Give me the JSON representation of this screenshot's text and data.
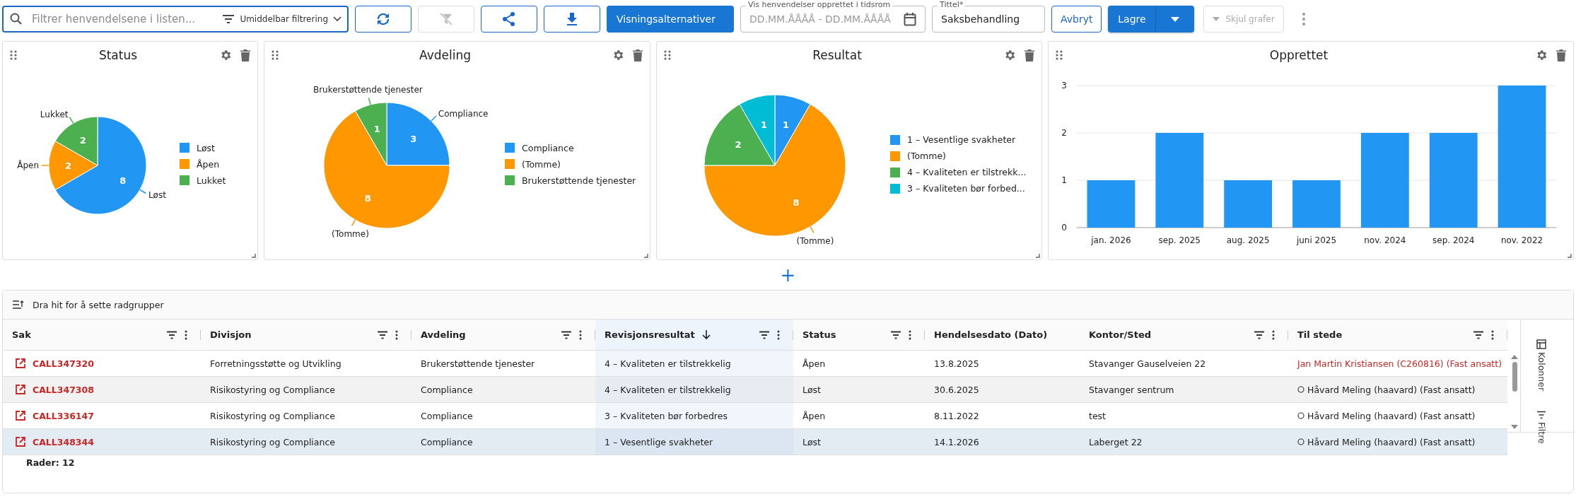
{
  "toolbar": {
    "search": {
      "placeholder": "Filtrer henvendelsene i listen...",
      "filter_mode": "Umiddelbar filtrering"
    },
    "icon_buttons": [
      {
        "kind": "refresh",
        "disabled": false
      },
      {
        "kind": "clear-filter",
        "disabled": true
      },
      {
        "kind": "share",
        "disabled": false
      },
      {
        "kind": "download",
        "disabled": false
      }
    ],
    "view_options": "Visningsalternativer",
    "date_range": {
      "label": "Vis henvendelser opprettet i tidsrom",
      "placeholder": "DD.MM.ÅÅÅÅ - DD.MM.ÅÅÅÅ"
    },
    "title_field": {
      "label": "Tittel*",
      "value": "Saksbehandling"
    },
    "cancel": "Avbryt",
    "save": "Lagre",
    "hide_charts": {
      "label": "Skjul grafer",
      "disabled": true
    }
  },
  "charts": [
    {
      "title": "Status",
      "chart_data": {
        "type": "pie",
        "categories": [
          "Løst",
          "Åpen",
          "Lukket"
        ],
        "values": [
          8,
          2,
          2
        ],
        "data_labels": true
      },
      "legend": [
        {
          "color": "#2196f3",
          "callout": true
        },
        {
          "color": "#ff9800",
          "callout": true
        },
        {
          "color": "#4caf50",
          "callout": true
        }
      ]
    },
    {
      "title": "Avdeling",
      "chart_data": {
        "type": "pie",
        "categories": [
          "Compliance",
          "(Tomme)",
          "Brukerstøttende tjenester"
        ],
        "values": [
          3,
          8,
          1
        ],
        "data_labels": true
      },
      "legend": [
        {
          "color": "#2196f3",
          "callout": true
        },
        {
          "color": "#ff9800",
          "callout": true
        },
        {
          "color": "#4caf50",
          "callout": true
        }
      ]
    },
    {
      "title": "Resultat",
      "chart_data": {
        "type": "pie",
        "categories": [
          "1 – Vesentlige svakheter",
          "(Tomme)",
          "4 – Kvaliteten er tilstrekk...",
          "3 – Kvaliteten bør forbed..."
        ],
        "values": [
          1,
          8,
          2,
          1
        ],
        "data_labels": true
      },
      "legend": [
        {
          "color": "#2196f3",
          "callout": false
        },
        {
          "color": "#ff9800",
          "callout": true
        },
        {
          "color": "#4caf50",
          "callout": false
        },
        {
          "color": "#00bcd4",
          "callout": false
        }
      ]
    },
    {
      "title": "Opprettet",
      "chart_data": {
        "type": "bar",
        "categories": [
          "jan. 2026",
          "sep. 2025",
          "aug. 2025",
          "juni 2025",
          "nov. 2024",
          "sep. 2024",
          "nov. 2022"
        ],
        "series": [
          {
            "color": "#2196f3",
            "values": [
              1,
              2,
              1,
              1,
              2,
              2,
              3
            ]
          }
        ],
        "ylim": [
          0,
          3
        ],
        "yticks": [
          0,
          1,
          2,
          3
        ]
      }
    }
  ],
  "add_chart": "+",
  "table": {
    "group_hint": "Dra hit for å sette radgrupper",
    "columns": [
      {
        "label": "Sak",
        "sorted": false
      },
      {
        "label": "Divisjon",
        "sorted": false
      },
      {
        "label": "Avdeling",
        "sorted": false
      },
      {
        "label": "Revisjonsresultat",
        "sorted": true
      },
      {
        "label": "Status",
        "sorted": false
      },
      {
        "label": "Hendelsesdato (Dato)",
        "sorted": false
      },
      {
        "label": "Kontor/Sted",
        "sorted": false
      },
      {
        "label": "Til stede",
        "sorted": false
      }
    ],
    "rows": [
      {
        "selected": false,
        "kind": "external",
        "cells": [
          "CALL347320",
          "Forretningsstøtte og Utvikling",
          "Brukerstøttende tjenester",
          "4 – Kvaliteten er tilstrekkelig",
          "Åpen",
          "13.8.2025",
          "Stavanger Gauselveien 22",
          "Jan Martin Kristiansen (C260816) (Fast ansatt)"
        ]
      },
      {
        "selected": false,
        "kind": "person",
        "cells": [
          "CALL347308",
          "Risikostyring og Compliance",
          "Compliance",
          "4 – Kvaliteten er tilstrekkelig",
          "Løst",
          "30.6.2025",
          "Stavanger sentrum",
          "Håvard Meling (haavard) (Fast ansatt)"
        ]
      },
      {
        "selected": false,
        "kind": "person",
        "cells": [
          "CALL336147",
          "Risikostyring og Compliance",
          "Compliance",
          "3 – Kvaliteten bør forbedres",
          "Åpen",
          "8.11.2022",
          "test",
          "Håvard Meling (haavard) (Fast ansatt)"
        ]
      },
      {
        "selected": true,
        "kind": "person",
        "cells": [
          "CALL348344",
          "Risikostyring og Compliance",
          "Compliance",
          "1 – Vesentlige svakheter",
          "Løst",
          "14.1.2026",
          "Laberget 22",
          "Håvard Meling (haavard) (Fast ansatt)"
        ]
      }
    ],
    "side_tabs": [
      "Kolonner",
      "Filtre"
    ],
    "footer": "Rader: 12"
  }
}
